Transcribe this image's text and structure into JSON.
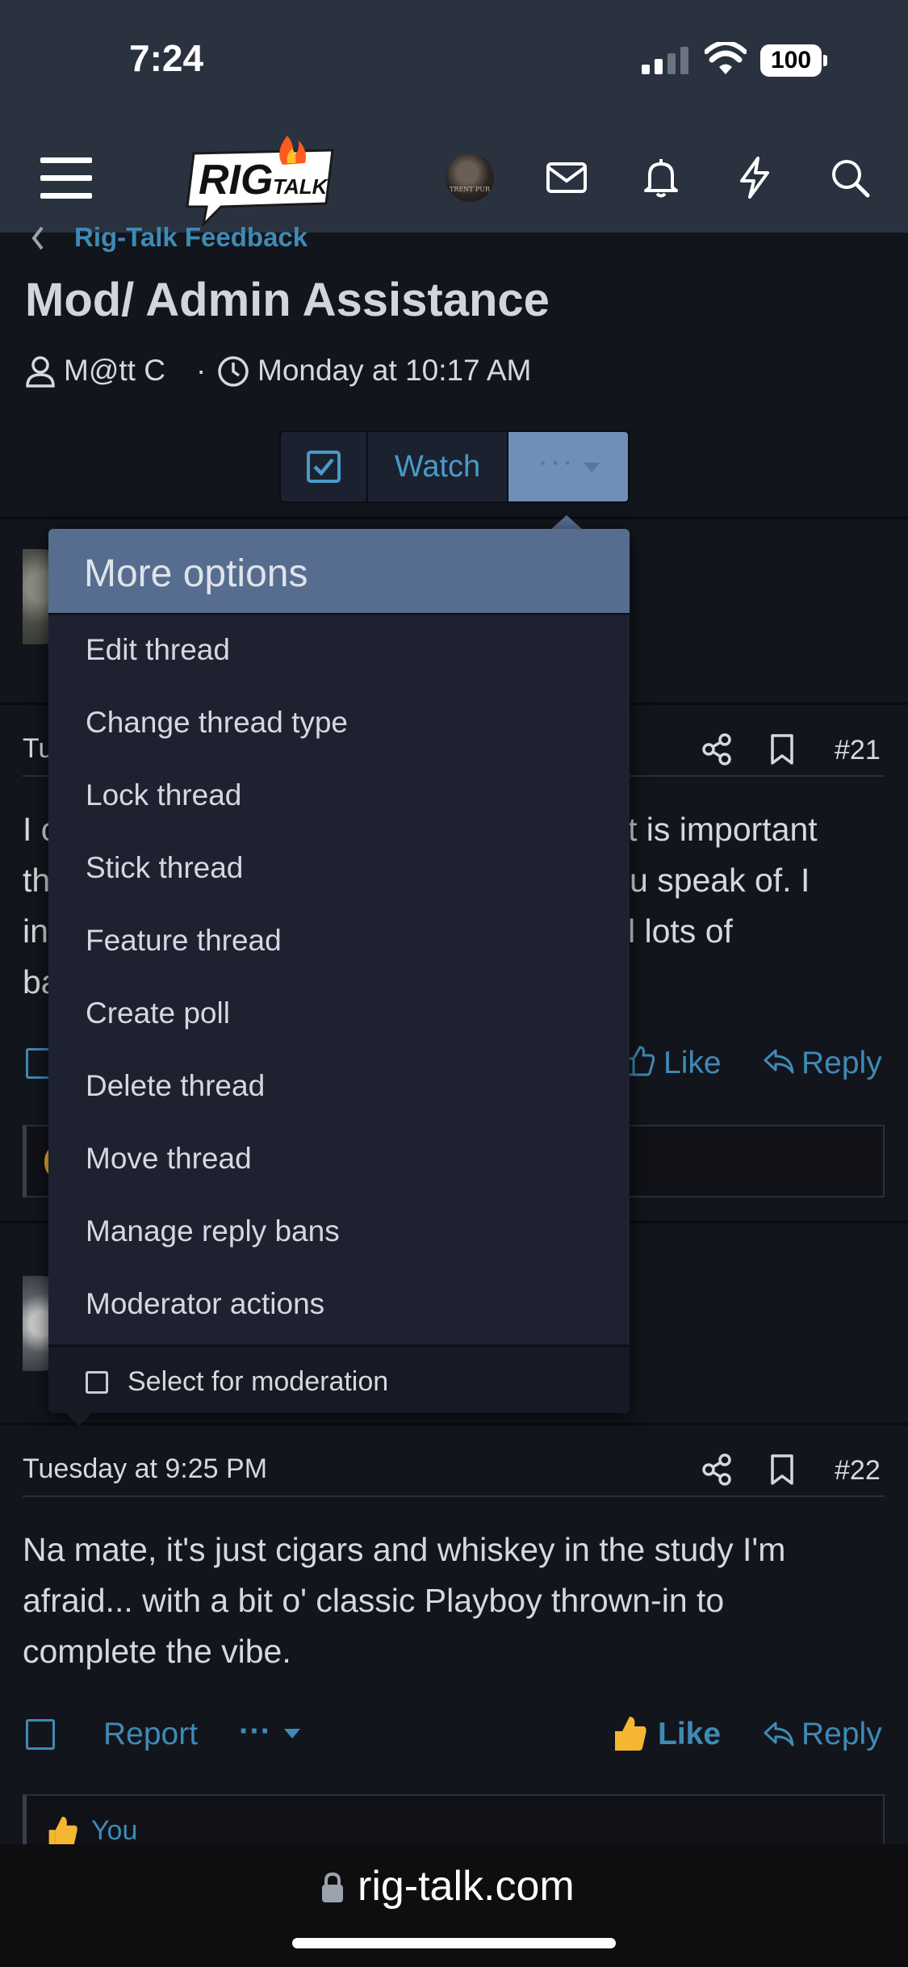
{
  "status": {
    "time": "7:24",
    "battery": "100"
  },
  "header": {
    "logo_text": "RIG",
    "logo_sub": "TALK",
    "avatar_text": "TRENT PUR"
  },
  "breadcrumb": {
    "label": "Rig-Talk Feedback"
  },
  "thread": {
    "title": "Mod/ Admin Assistance",
    "author": "M@tt C",
    "separator": "·",
    "date": "Monday at 10:17 AM"
  },
  "actions": {
    "watch_label": "Watch",
    "more_label": "···"
  },
  "menu": {
    "header": "More options",
    "items": [
      "Edit thread",
      "Change thread type",
      "Lock thread",
      "Stick thread",
      "Feature thread",
      "Create poll",
      "Delete thread",
      "Move thread",
      "Manage reply bans",
      "Moderator actions"
    ],
    "footer": "Select for moderation"
  },
  "post1": {
    "date_fragment": "Tu",
    "number": "#21",
    "lines": [
      {
        "left": "I c",
        "right": "t is important"
      },
      {
        "left": "th",
        "right": "u speak of. I"
      },
      {
        "left": "in",
        "right": "l lots of"
      },
      {
        "left": "ba",
        "right": ""
      }
    ],
    "like_label": "Like",
    "reply_label": "Reply"
  },
  "post2": {
    "date": "Tuesday at 9:25 PM",
    "number": "#22",
    "body_lines": [
      "Na mate, it's just cigars and whiskey in the study I'm",
      "afraid... with a bit o' classic Playboy thrown-in to",
      "complete the vibe."
    ],
    "report_label": "Report",
    "more_label": "···",
    "like_label": "Like",
    "reply_label": "Reply",
    "reaction_user": "You"
  },
  "browser": {
    "url": "rig-talk.com"
  }
}
